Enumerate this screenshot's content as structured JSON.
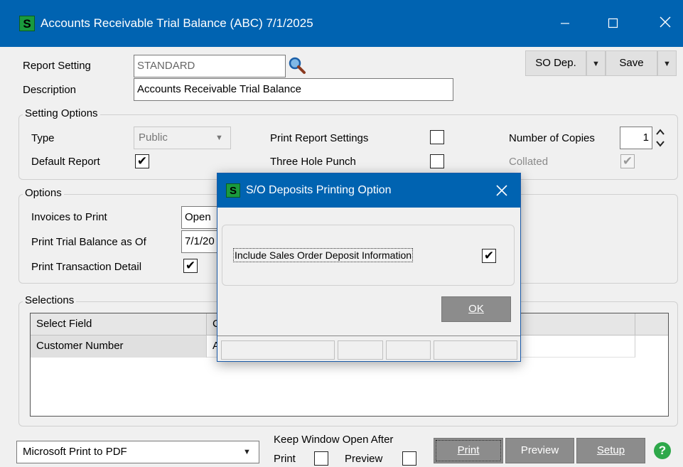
{
  "window": {
    "title": "Accounts Receivable Trial Balance (ABC) 7/1/2025",
    "app_icon": "S"
  },
  "header": {
    "report_setting_label": "Report Setting",
    "report_setting_value": "STANDARD",
    "description_label": "Description",
    "description_value": "Accounts Receivable Trial Balance",
    "so_dep_button": "SO Dep.",
    "save_button": "Save"
  },
  "setting_options": {
    "title": "Setting Options",
    "type_label": "Type",
    "type_value": "Public",
    "default_report_label": "Default Report",
    "default_report_checked": true,
    "print_report_settings_label": "Print Report Settings",
    "print_report_settings_checked": false,
    "three_hole_punch_label": "Three Hole Punch",
    "three_hole_punch_checked": false,
    "number_of_copies_label": "Number of Copies",
    "number_of_copies_value": "1",
    "collated_label": "Collated",
    "collated_checked": true
  },
  "options": {
    "title": "Options",
    "invoices_to_print_label": "Invoices to Print",
    "invoices_to_print_value": "Open",
    "print_trial_balance_label": "Print Trial Balance as Of",
    "print_trial_balance_value": "7/1/20",
    "print_transaction_detail_label": "Print Transaction Detail",
    "print_transaction_detail_checked": true
  },
  "selections": {
    "title": "Selections",
    "columns": [
      "Select Field",
      "C"
    ],
    "rows": [
      [
        "Customer Number",
        "A"
      ]
    ]
  },
  "footer": {
    "printer_value": "Microsoft Print to PDF",
    "keep_window_open_label": "Keep Window Open After",
    "print_label": "Print",
    "preview_label": "Preview",
    "print_button": "Print",
    "preview_button": "Preview",
    "setup_button": "Setup",
    "help_icon": "?"
  },
  "dialog": {
    "title": "S/O Deposits Printing Option",
    "app_icon": "S",
    "include_label": "Include Sales Order Deposit Information",
    "include_checked": true,
    "ok_button": "OK"
  },
  "check_mark": "✔"
}
